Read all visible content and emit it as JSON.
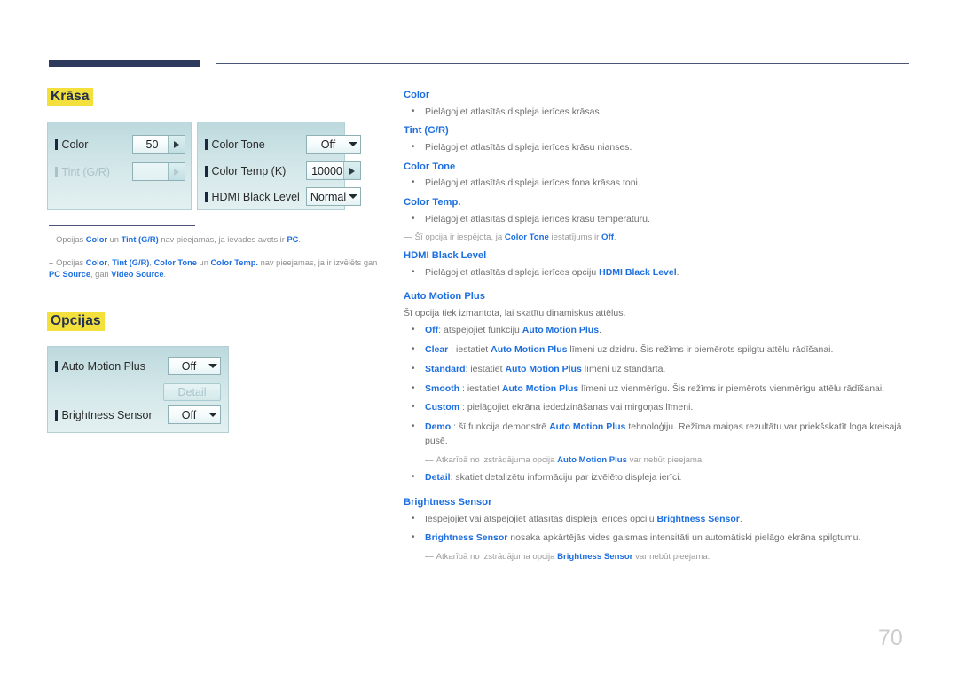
{
  "page": {
    "number": "70"
  },
  "sections": {
    "color": {
      "heading": "Krāsa"
    },
    "options": {
      "heading": "Opcijas"
    }
  },
  "osd": {
    "color_panel": {
      "rows": [
        {
          "label": "Color",
          "value": "50",
          "control": "spinner",
          "enabled": true
        },
        {
          "label": "Tint (G/R)",
          "value": "",
          "control": "spinner",
          "enabled": false
        }
      ]
    },
    "tone_panel": {
      "rows": [
        {
          "label": "Color Tone",
          "value": "Off",
          "control": "dropdown",
          "enabled": true
        },
        {
          "label": "Color Temp (K)",
          "value": "10000",
          "control": "spinner",
          "enabled": true
        },
        {
          "label": "HDMI Black Level",
          "value": "Normal",
          "control": "dropdown",
          "enabled": true
        }
      ]
    },
    "options_panel": {
      "rows": [
        {
          "label": "Auto Motion Plus",
          "value": "Off",
          "control": "dropdown",
          "enabled": true
        },
        {
          "label": "Brightness Sensor",
          "value": "Off",
          "control": "dropdown",
          "enabled": true
        }
      ],
      "detail_button": "Detail"
    }
  },
  "left_notes": {
    "note1": {
      "dash": "–",
      "parts": [
        {
          "t": "Opcijas ",
          "b": false
        },
        {
          "t": "Color",
          "b": true
        },
        {
          "t": " un ",
          "b": false
        },
        {
          "t": "Tint (G/R)",
          "b": true
        },
        {
          "t": " nav pieejamas, ja ievades avots ir ",
          "b": false
        },
        {
          "t": "PC",
          "b": true
        },
        {
          "t": ".",
          "b": false
        }
      ]
    },
    "note2": {
      "dash": "–",
      "parts": [
        {
          "t": "Opcijas ",
          "b": false
        },
        {
          "t": "Color",
          "b": true
        },
        {
          "t": ", ",
          "b": false
        },
        {
          "t": "Tint (G/R)",
          "b": true
        },
        {
          "t": ", ",
          "b": false
        },
        {
          "t": "Color Tone",
          "b": true
        },
        {
          "t": " un ",
          "b": false
        },
        {
          "t": "Color Temp.",
          "b": true
        },
        {
          "t": " nav pieejamas, ja ir izvēlēts gan ",
          "b": false
        },
        {
          "t": "PC Source",
          "b": true
        },
        {
          "t": ", gan ",
          "b": false
        },
        {
          "t": "Video Source",
          "b": true
        },
        {
          "t": ".",
          "b": false
        }
      ]
    }
  },
  "right_column": [
    {
      "kind": "head",
      "parts": [
        {
          "t": "Color",
          "b": true
        }
      ]
    },
    {
      "kind": "li",
      "parts": [
        {
          "t": "Pielāgojiet atlasītās displeja ierīces krāsas.",
          "b": false
        }
      ]
    },
    {
      "kind": "head",
      "parts": [
        {
          "t": "Tint (G/R)",
          "b": true
        }
      ]
    },
    {
      "kind": "li",
      "parts": [
        {
          "t": "Pielāgojiet atlasītās displeja ierīces krāsu nianses.",
          "b": false
        }
      ]
    },
    {
      "kind": "head",
      "parts": [
        {
          "t": "Color Tone",
          "b": true
        }
      ]
    },
    {
      "kind": "li",
      "parts": [
        {
          "t": "Pielāgojiet atlasītās displeja ierīces fona krāsas toni.",
          "b": false
        }
      ]
    },
    {
      "kind": "head",
      "parts": [
        {
          "t": "Color Temp.",
          "b": true
        }
      ]
    },
    {
      "kind": "li",
      "parts": [
        {
          "t": "Pielāgojiet atlasītās displeja ierīces krāsu temperatūru.",
          "b": false
        }
      ]
    },
    {
      "kind": "sub",
      "dash": "―",
      "parts": [
        {
          "t": "Šī opcija ir iespējota, ja ",
          "b": false
        },
        {
          "t": "Color Tone",
          "b": true
        },
        {
          "t": " iestatījums ir ",
          "b": false
        },
        {
          "t": "Off",
          "b": true
        },
        {
          "t": ".",
          "b": false
        }
      ]
    },
    {
      "kind": "head",
      "parts": [
        {
          "t": "HDMI Black Level",
          "b": true
        }
      ]
    },
    {
      "kind": "li",
      "parts": [
        {
          "t": "Pielāgojiet atlasītās displeja ierīces opciju ",
          "b": false
        },
        {
          "t": "HDMI Black Level",
          "b": true
        },
        {
          "t": ".",
          "b": false
        }
      ]
    },
    {
      "kind": "head",
      "gap": true,
      "parts": [
        {
          "t": "Auto Motion Plus",
          "b": true
        }
      ]
    },
    {
      "kind": "para",
      "parts": [
        {
          "t": "Šī opcija tiek izmantota, lai skatītu dinamiskus attēlus.",
          "b": false
        }
      ]
    },
    {
      "kind": "li",
      "parts": [
        {
          "t": "Off",
          "b": true
        },
        {
          "t": ": atspējojiet funkciju ",
          "b": false
        },
        {
          "t": "Auto Motion Plus",
          "b": true
        },
        {
          "t": ".",
          "b": false
        }
      ]
    },
    {
      "kind": "li",
      "parts": [
        {
          "t": "Clear",
          "b": true
        },
        {
          "t": " : iestatiet ",
          "b": false
        },
        {
          "t": "Auto Motion Plus",
          "b": true
        },
        {
          "t": " līmeni uz dzidru. Šis režīms ir piemērots spilgtu attēlu rādīšanai.",
          "b": false
        }
      ]
    },
    {
      "kind": "li",
      "parts": [
        {
          "t": "Standard",
          "b": true
        },
        {
          "t": ": iestatiet ",
          "b": false
        },
        {
          "t": "Auto Motion Plus",
          "b": true
        },
        {
          "t": " līmeni uz standarta.",
          "b": false
        }
      ]
    },
    {
      "kind": "li",
      "parts": [
        {
          "t": "Smooth",
          "b": true
        },
        {
          "t": " : iestatiet ",
          "b": false
        },
        {
          "t": "Auto Motion Plus",
          "b": true
        },
        {
          "t": " līmeni uz vienmērīgu. Šis režīms ir piemērots vienmērīgu attēlu rādīšanai.",
          "b": false
        }
      ]
    },
    {
      "kind": "li",
      "parts": [
        {
          "t": "Custom",
          "b": true
        },
        {
          "t": " : pielāgojiet ekrāna iededzināšanas vai mirgoņas līmeni.",
          "b": false
        }
      ]
    },
    {
      "kind": "li",
      "parts": [
        {
          "t": "Demo",
          "b": true
        },
        {
          "t": " : šī funkcija demonstrē ",
          "b": false
        },
        {
          "t": "Auto Motion Plus",
          "b": true
        },
        {
          "t": " tehnoloģiju. Režīma maiņas rezultātu var priekšskatīt loga kreisajā pusē.",
          "b": false
        }
      ]
    },
    {
      "kind": "sub",
      "indent": true,
      "dash": "―",
      "parts": [
        {
          "t": "Atkarībā no izstrādājuma opcija ",
          "b": false
        },
        {
          "t": "Auto Motion Plus",
          "b": true
        },
        {
          "t": " var nebūt pieejama.",
          "b": false
        }
      ]
    },
    {
      "kind": "li",
      "parts": [
        {
          "t": "Detail",
          "b": true
        },
        {
          "t": ": skatiet detalizētu informāciju par izvēlēto displeja ierīci.",
          "b": false
        }
      ]
    },
    {
      "kind": "head",
      "gap": true,
      "parts": [
        {
          "t": "Brightness Sensor",
          "b": true
        }
      ]
    },
    {
      "kind": "li",
      "parts": [
        {
          "t": "Iespējojiet vai atspējojiet atlasītās displeja ierīces opciju ",
          "b": false
        },
        {
          "t": "Brightness Sensor",
          "b": true
        },
        {
          "t": ".",
          "b": false
        }
      ]
    },
    {
      "kind": "li",
      "parts": [
        {
          "t": "Brightness Sensor",
          "b": true
        },
        {
          "t": " nosaka apkārtējās vides gaismas intensitāti un automātiski pielāgo ekrāna spilgtumu.",
          "b": false
        }
      ]
    },
    {
      "kind": "sub",
      "indent": true,
      "dash": "―",
      "parts": [
        {
          "t": "Atkarībā no izstrādājuma opcija ",
          "b": false
        },
        {
          "t": "Brightness Sensor",
          "b": true
        },
        {
          "t": " var nebūt pieejama.",
          "b": false
        }
      ]
    }
  ]
}
